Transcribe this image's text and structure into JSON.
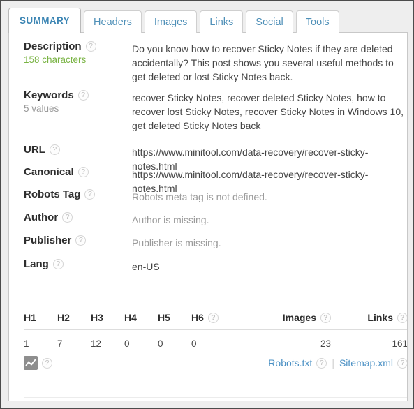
{
  "window": {
    "background_color": "#eeeeee",
    "border_color": "#4c4c4c"
  },
  "theme": {
    "accent_blue": "#4f90b8",
    "active_tab_blue": "#3d86b4",
    "green": "#79b343",
    "muted_gray": "#9a9a9a",
    "label_dark": "#2e2e2e",
    "link_blue": "#4a90c4"
  },
  "tabs": [
    {
      "label": "SUMMARY",
      "active": true
    },
    {
      "label": "Headers",
      "active": false
    },
    {
      "label": "Images",
      "active": false
    },
    {
      "label": "Links",
      "active": false
    },
    {
      "label": "Social",
      "active": false
    },
    {
      "label": "Tools",
      "active": false
    }
  ],
  "help_icon": {
    "glyph": "?",
    "name": "help-icon"
  },
  "rows": [
    {
      "label": "Description",
      "sub": "158 characters",
      "sub_style": "green",
      "value": "Do you know how to recover Sticky Notes if they are deleted accidentally? This post shows you several useful methods to get deleted or lost Sticky Notes back.",
      "value_style": "normal"
    },
    {
      "label": "Keywords",
      "sub": "5 values",
      "sub_style": "muted",
      "value": "recover Sticky Notes, recover deleted Sticky Notes, how to recover lost Sticky Notes, recover Sticky Notes in Windows 10, get deleted Sticky Notes back",
      "value_style": "normal"
    },
    {
      "label": "URL",
      "sub": "",
      "sub_style": "none",
      "value": "https://www.minitool.com/data-recovery/recover-sticky-notes.html",
      "value_style": "normal"
    },
    {
      "label": "Canonical",
      "sub": "",
      "sub_style": "none",
      "value": "https://www.minitool.com/data-recovery/recover-sticky-notes.html",
      "value_style": "normal"
    },
    {
      "label": "Robots Tag",
      "sub": "",
      "sub_style": "none",
      "value": "Robots meta tag is not defined.",
      "value_style": "muted"
    },
    {
      "label": "Author",
      "sub": "",
      "sub_style": "none",
      "value": "Author is missing.",
      "value_style": "muted"
    },
    {
      "label": "Publisher",
      "sub": "",
      "sub_style": "none",
      "value": "Publisher is missing.",
      "value_style": "muted"
    },
    {
      "label": "Lang",
      "sub": "",
      "sub_style": "none",
      "value": "en-US",
      "value_style": "normal"
    }
  ],
  "metrics": {
    "columns": [
      {
        "label": "H1",
        "help": false,
        "align": "left"
      },
      {
        "label": "H2",
        "help": false,
        "align": "left"
      },
      {
        "label": "H3",
        "help": false,
        "align": "left"
      },
      {
        "label": "H4",
        "help": false,
        "align": "left"
      },
      {
        "label": "H5",
        "help": false,
        "align": "left"
      },
      {
        "label": "H6",
        "help": true,
        "align": "left"
      },
      {
        "label": "Images",
        "help": true,
        "align": "right"
      },
      {
        "label": "Links",
        "help": true,
        "align": "right"
      }
    ],
    "values": [
      "1",
      "7",
      "12",
      "0",
      "0",
      "0",
      "23",
      "161"
    ]
  },
  "footer": {
    "chart_icon_name": "line-chart-icon",
    "links": [
      {
        "label": "Robots.txt",
        "help": true
      },
      {
        "label": "Sitemap.xml",
        "help": true
      }
    ],
    "separator": "|"
  }
}
